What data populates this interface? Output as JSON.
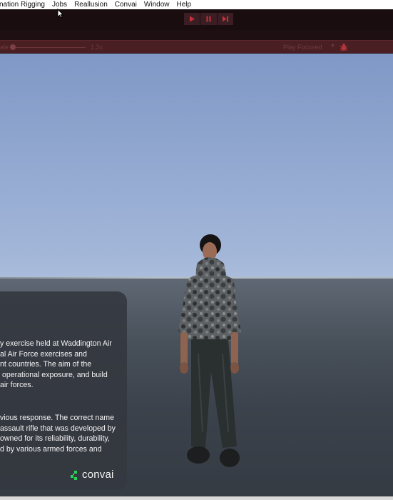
{
  "menubar": {
    "items": [
      "nation Rigging",
      "Jobs",
      "Reallusion",
      "Convai",
      "Window",
      "Help"
    ]
  },
  "toolbar": {
    "play_icon": "play-icon",
    "pause_icon": "pause-icon",
    "step_icon": "step-icon",
    "accent_color": "#c0303a"
  },
  "game_view": {
    "scale_label": "ale",
    "scale_value": "1.3x",
    "play_mode": "Play Focused",
    "bug_icon": "bug-icon"
  },
  "chat": {
    "message_1": "y exercise held at Waddington Air\nal Air Force exercises and\nnt countries. The aim of the\n operational exposure, and build\nair forces.",
    "message_2": "vious response. The correct name\nassault rifle that was developed by\nowned for its reliability, durability,\nd by various armed forces and",
    "brand": "convai",
    "brand_color": "#2ed158"
  }
}
